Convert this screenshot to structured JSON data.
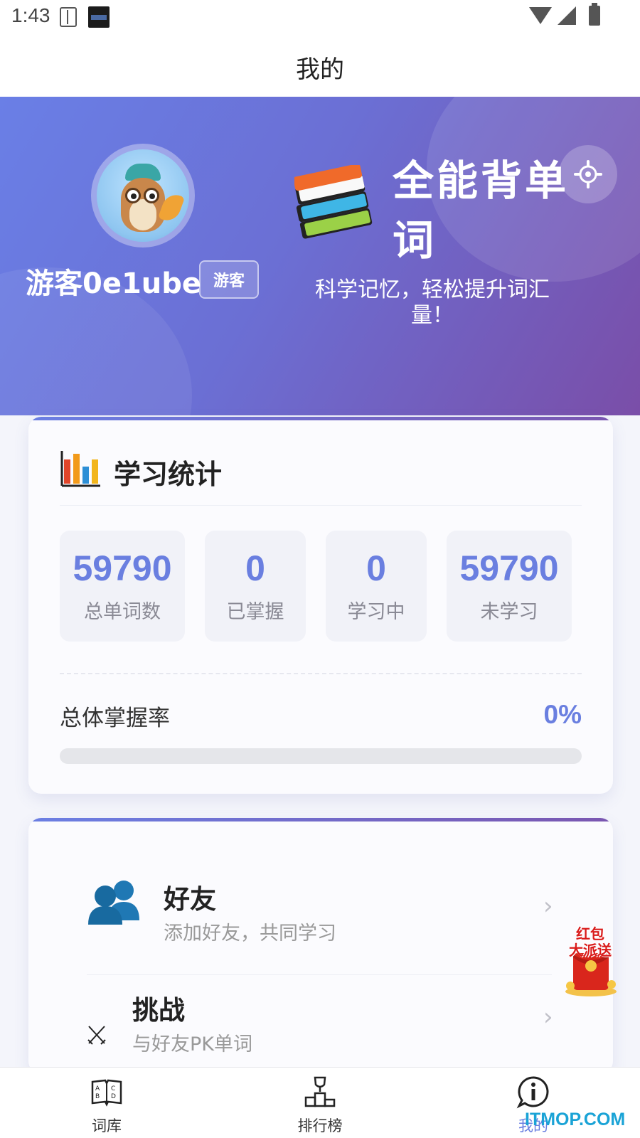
{
  "status_bar": {
    "time": "1:43"
  },
  "title_bar": {
    "title": "我的"
  },
  "profile": {
    "username": "游客0e1ube",
    "badge": "游客",
    "app_name": "全能背单词",
    "slogan": "科学记忆，轻松提升词汇量！"
  },
  "stats": {
    "title": "学习统计",
    "items": [
      {
        "value": "59790",
        "label": "总单词数"
      },
      {
        "value": "0",
        "label": "已掌握"
      },
      {
        "value": "0",
        "label": "学习中"
      },
      {
        "value": "59790",
        "label": "未学习"
      }
    ],
    "mastery_label": "总体掌握率",
    "mastery_value": "0%",
    "mastery_progress": 0
  },
  "menu": {
    "items": [
      {
        "title": "好友",
        "subtitle": "添加好友，共同学习",
        "icon": "friends-icon"
      },
      {
        "title": "挑战",
        "subtitle": "与好友PK单词",
        "icon": "swords-icon"
      }
    ]
  },
  "red_packet": {
    "line1": "红包",
    "line2": "大派送"
  },
  "bottom_nav": {
    "items": [
      {
        "label": "词库",
        "icon": "dictionary-icon",
        "active": false
      },
      {
        "label": "排行榜",
        "icon": "podium-icon",
        "active": false
      },
      {
        "label": "我的",
        "icon": "info-icon",
        "active": true
      }
    ]
  },
  "watermark": "ITMOP.COM",
  "colors": {
    "accent": "#6a7fe0",
    "header_start": "#6a7fe6",
    "header_end": "#7a4ea8"
  }
}
